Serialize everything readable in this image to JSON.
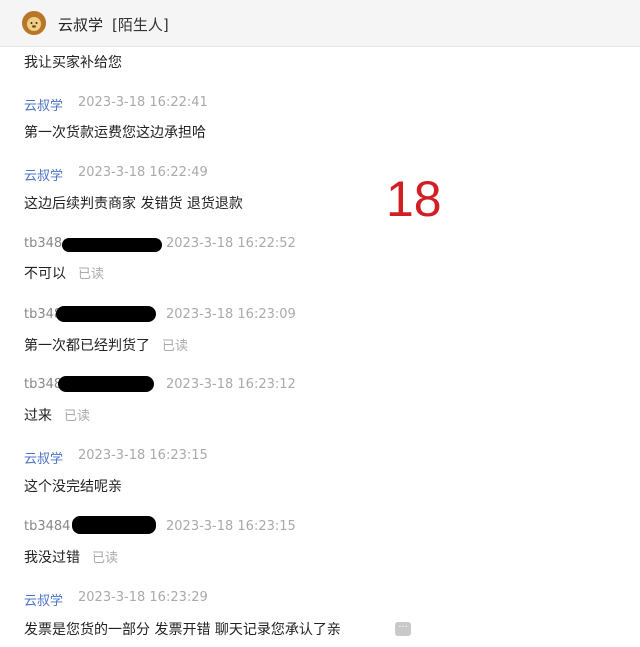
{
  "header": {
    "contact_name": "云叔学",
    "contact_tag": "[陌生人]"
  },
  "overlay_number": "18",
  "read_label": "已读",
  "messages": [
    {
      "text": "我让买家补给您"
    },
    {
      "sender": "云叔学",
      "time": "2023-3-18 16:22:41",
      "text": "第一次货款运费您这边承担哈"
    },
    {
      "sender": "云叔学",
      "time": "2023-3-18 16:22:49",
      "text": "这边后续判责商家 发错货 退货退款"
    },
    {
      "sender": "tb348",
      "time": "2023-3-18 16:22:52",
      "text": "不可以"
    },
    {
      "sender": "tb348",
      "time": "2023-3-18 16:23:09",
      "text": "第一次都已经判货了"
    },
    {
      "sender": "tb348",
      "time": "2023-3-18 16:23:12",
      "text": "过来"
    },
    {
      "sender": "云叔学",
      "time": "2023-3-18 16:23:15",
      "text": "这个没完结呢亲"
    },
    {
      "sender": "tb3484",
      "time": "2023-3-18 16:23:15",
      "text": "我没过错"
    },
    {
      "sender": "云叔学",
      "time": "2023-3-18 16:23:29",
      "text": "发票是您货的一部分 发票开错 聊天记录您承认了亲"
    }
  ],
  "icons": {
    "avatar": "lion-avatar-icon",
    "more": "more-dots-icon"
  }
}
